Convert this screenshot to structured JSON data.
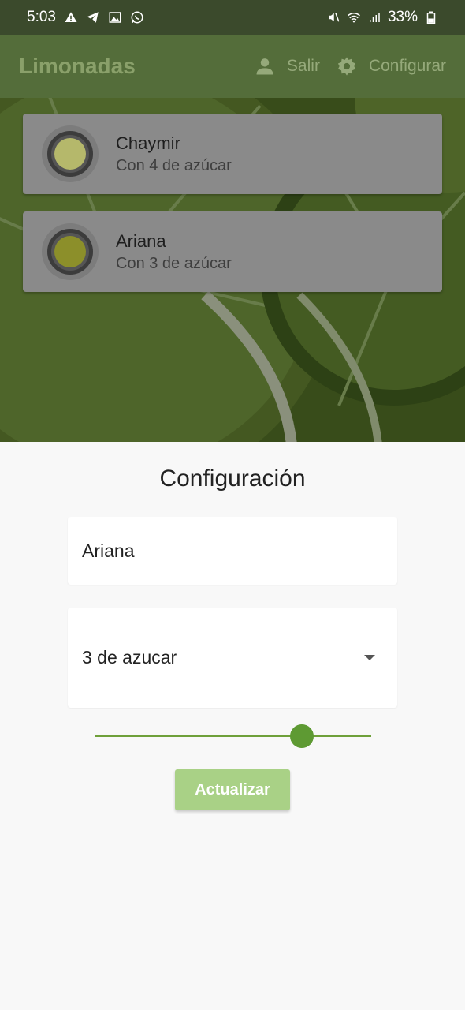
{
  "status_bar": {
    "time": "5:03",
    "battery": "33%",
    "icons": [
      "warning-icon",
      "telegram-icon",
      "gallery-icon",
      "whatsapp-icon",
      "mute-icon",
      "wifi-icon",
      "signal-icon",
      "battery-icon"
    ]
  },
  "app_bar": {
    "title": "Limonadas",
    "logout_label": "Salir",
    "settings_label": "Configurar"
  },
  "list": {
    "items": [
      {
        "name": "Chaymir",
        "subtitle": "Con 4 de azúcar",
        "fill_color": "#b5b86b"
      },
      {
        "name": "Ariana",
        "subtitle": "Con 3 de azúcar",
        "fill_color": "#8c8f2a"
      }
    ]
  },
  "config": {
    "title": "Configuración",
    "name_value": "Ariana",
    "sugar_selected": "3 de azucar",
    "slider_fraction": 0.75,
    "update_label": "Actualizar"
  },
  "colors": {
    "accent": "#5e9a33",
    "button": "#a9d186",
    "app_bar": "#546d3a"
  }
}
